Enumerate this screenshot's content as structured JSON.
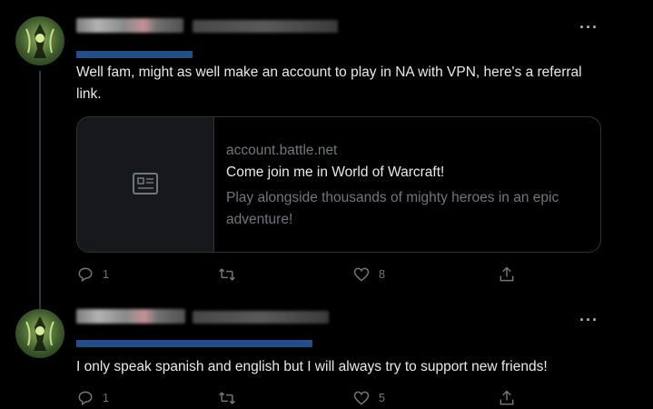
{
  "tweets": [
    {
      "text": "Well fam, might as well make an account to play in NA with VPN, here's a referral link.",
      "card": {
        "domain": "account.battle.net",
        "title": "Come join me in World of Warcraft!",
        "description": "Play alongside thousands of mighty heroes in an epic adventure!"
      },
      "actions": {
        "replies": "1",
        "likes": "8"
      }
    },
    {
      "text": "I only speak spanish and english but I will always try to support new friends!",
      "actions": {
        "replies": "1",
        "likes": "5"
      }
    }
  ],
  "icons": {
    "more": "more-icon",
    "reply": "reply-icon",
    "retweet": "retweet-icon",
    "like": "heart-icon",
    "share": "share-icon",
    "card_thumbnail": "article-icon"
  },
  "colors": {
    "background": "#000000",
    "text": "#e7e9ea",
    "secondary": "#71767b",
    "border": "#2f3336"
  }
}
